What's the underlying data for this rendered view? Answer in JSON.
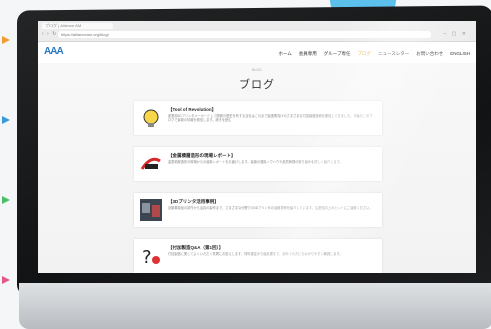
{
  "browser": {
    "tab_title": "ブログ | Allience AM",
    "address": "https://allianceam.org/blog/",
    "nav_glyphs": "‹ › ↻",
    "window_controls": "– ▢ ✕"
  },
  "site": {
    "logo": "AAA",
    "nav": [
      {
        "label": "ホーム",
        "active": false
      },
      {
        "label": "会員専用",
        "active": false
      },
      {
        "label": "グループ専任",
        "active": false
      },
      {
        "label": "ブログ",
        "active": true
      },
      {
        "label": "ニュースレター",
        "active": false
      },
      {
        "label": "お問い合わせ",
        "active": false
      },
      {
        "label": "ENGLISH",
        "active": false
      }
    ]
  },
  "blog": {
    "subtitle": "BLOG",
    "title": "ブログ",
    "posts": [
      {
        "title": "【Tool of Revolution】",
        "excerpt": "産業用3Dプリンタメーカーとして開発の歴史を有する当社はこれまで製造業向けのさまざまな付加製造技術を発信してきました。今後もこのブログで最新の情報を発信します。続きを読む"
      },
      {
        "title": "【金属積層造形の現場レポート】",
        "excerpt": "金属積層造形の現場からの最新レポートをお届けします。装置の運用ノウハウや品質管理の取り組みを詳しく紹介します。"
      },
      {
        "title": "【3Dプリンタ活用事例】",
        "excerpt": "自動車部品の試作から治具の製作まで、さまざまな分野での3Dプリンタの活用事例を紹介しています。生産性向上のヒントにご活用ください。"
      },
      {
        "title": "【付加製造Q&A（第1回）】",
        "excerpt": "付加製造に関してよくいただく質問にお答えします。材料選定から後処理まで、初めての方にもわかりやすく解説します。"
      }
    ]
  }
}
